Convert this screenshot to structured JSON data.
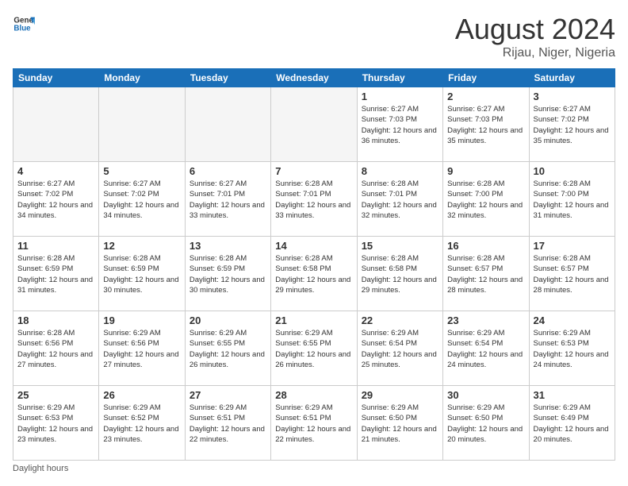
{
  "logo": {
    "line1": "General",
    "line2": "Blue"
  },
  "header": {
    "month": "August 2024",
    "location": "Rijau, Niger, Nigeria"
  },
  "weekdays": [
    "Sunday",
    "Monday",
    "Tuesday",
    "Wednesday",
    "Thursday",
    "Friday",
    "Saturday"
  ],
  "weeks": [
    [
      {
        "day": "",
        "info": ""
      },
      {
        "day": "",
        "info": ""
      },
      {
        "day": "",
        "info": ""
      },
      {
        "day": "",
        "info": ""
      },
      {
        "day": "1",
        "info": "Sunrise: 6:27 AM\nSunset: 7:03 PM\nDaylight: 12 hours\nand 36 minutes."
      },
      {
        "day": "2",
        "info": "Sunrise: 6:27 AM\nSunset: 7:03 PM\nDaylight: 12 hours\nand 35 minutes."
      },
      {
        "day": "3",
        "info": "Sunrise: 6:27 AM\nSunset: 7:02 PM\nDaylight: 12 hours\nand 35 minutes."
      }
    ],
    [
      {
        "day": "4",
        "info": "Sunrise: 6:27 AM\nSunset: 7:02 PM\nDaylight: 12 hours\nand 34 minutes."
      },
      {
        "day": "5",
        "info": "Sunrise: 6:27 AM\nSunset: 7:02 PM\nDaylight: 12 hours\nand 34 minutes."
      },
      {
        "day": "6",
        "info": "Sunrise: 6:27 AM\nSunset: 7:01 PM\nDaylight: 12 hours\nand 33 minutes."
      },
      {
        "day": "7",
        "info": "Sunrise: 6:28 AM\nSunset: 7:01 PM\nDaylight: 12 hours\nand 33 minutes."
      },
      {
        "day": "8",
        "info": "Sunrise: 6:28 AM\nSunset: 7:01 PM\nDaylight: 12 hours\nand 32 minutes."
      },
      {
        "day": "9",
        "info": "Sunrise: 6:28 AM\nSunset: 7:00 PM\nDaylight: 12 hours\nand 32 minutes."
      },
      {
        "day": "10",
        "info": "Sunrise: 6:28 AM\nSunset: 7:00 PM\nDaylight: 12 hours\nand 31 minutes."
      }
    ],
    [
      {
        "day": "11",
        "info": "Sunrise: 6:28 AM\nSunset: 6:59 PM\nDaylight: 12 hours\nand 31 minutes."
      },
      {
        "day": "12",
        "info": "Sunrise: 6:28 AM\nSunset: 6:59 PM\nDaylight: 12 hours\nand 30 minutes."
      },
      {
        "day": "13",
        "info": "Sunrise: 6:28 AM\nSunset: 6:59 PM\nDaylight: 12 hours\nand 30 minutes."
      },
      {
        "day": "14",
        "info": "Sunrise: 6:28 AM\nSunset: 6:58 PM\nDaylight: 12 hours\nand 29 minutes."
      },
      {
        "day": "15",
        "info": "Sunrise: 6:28 AM\nSunset: 6:58 PM\nDaylight: 12 hours\nand 29 minutes."
      },
      {
        "day": "16",
        "info": "Sunrise: 6:28 AM\nSunset: 6:57 PM\nDaylight: 12 hours\nand 28 minutes."
      },
      {
        "day": "17",
        "info": "Sunrise: 6:28 AM\nSunset: 6:57 PM\nDaylight: 12 hours\nand 28 minutes."
      }
    ],
    [
      {
        "day": "18",
        "info": "Sunrise: 6:28 AM\nSunset: 6:56 PM\nDaylight: 12 hours\nand 27 minutes."
      },
      {
        "day": "19",
        "info": "Sunrise: 6:29 AM\nSunset: 6:56 PM\nDaylight: 12 hours\nand 27 minutes."
      },
      {
        "day": "20",
        "info": "Sunrise: 6:29 AM\nSunset: 6:55 PM\nDaylight: 12 hours\nand 26 minutes."
      },
      {
        "day": "21",
        "info": "Sunrise: 6:29 AM\nSunset: 6:55 PM\nDaylight: 12 hours\nand 26 minutes."
      },
      {
        "day": "22",
        "info": "Sunrise: 6:29 AM\nSunset: 6:54 PM\nDaylight: 12 hours\nand 25 minutes."
      },
      {
        "day": "23",
        "info": "Sunrise: 6:29 AM\nSunset: 6:54 PM\nDaylight: 12 hours\nand 24 minutes."
      },
      {
        "day": "24",
        "info": "Sunrise: 6:29 AM\nSunset: 6:53 PM\nDaylight: 12 hours\nand 24 minutes."
      }
    ],
    [
      {
        "day": "25",
        "info": "Sunrise: 6:29 AM\nSunset: 6:53 PM\nDaylight: 12 hours\nand 23 minutes."
      },
      {
        "day": "26",
        "info": "Sunrise: 6:29 AM\nSunset: 6:52 PM\nDaylight: 12 hours\nand 23 minutes."
      },
      {
        "day": "27",
        "info": "Sunrise: 6:29 AM\nSunset: 6:51 PM\nDaylight: 12 hours\nand 22 minutes."
      },
      {
        "day": "28",
        "info": "Sunrise: 6:29 AM\nSunset: 6:51 PM\nDaylight: 12 hours\nand 22 minutes."
      },
      {
        "day": "29",
        "info": "Sunrise: 6:29 AM\nSunset: 6:50 PM\nDaylight: 12 hours\nand 21 minutes."
      },
      {
        "day": "30",
        "info": "Sunrise: 6:29 AM\nSunset: 6:50 PM\nDaylight: 12 hours\nand 20 minutes."
      },
      {
        "day": "31",
        "info": "Sunrise: 6:29 AM\nSunset: 6:49 PM\nDaylight: 12 hours\nand 20 minutes."
      }
    ]
  ],
  "footer": "Daylight hours"
}
